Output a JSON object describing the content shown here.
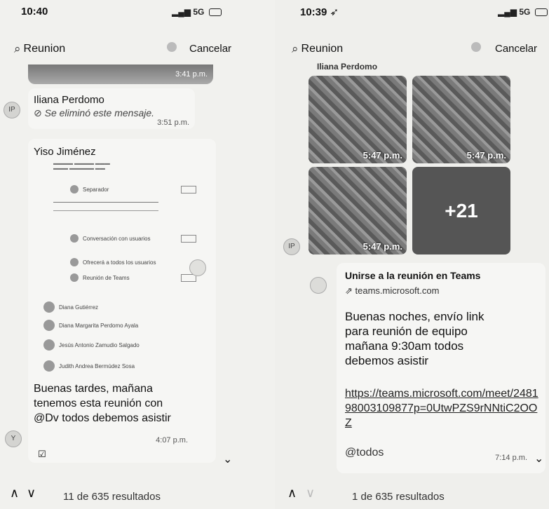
{
  "left": {
    "status_time": "10:40",
    "signal": "5G",
    "search_query": "Reunion",
    "cancel_label": "Cancelar",
    "top_image_time": "3:41 p.m.",
    "msg1": {
      "author": "Iliana Perdomo",
      "text": "Se eliminó este mensaje.",
      "time": "3:51 p.m."
    },
    "msg2": {
      "author": "Yiso Jiménez",
      "teams_rows": [
        "Separador",
        "Conversación con usuarios",
        "Ofrecerá a todos los usuarios",
        "Reunión de Teams"
      ],
      "participants": [
        "Diana Gutiérrez",
        "Diana Margarita Perdomo Ayala",
        "Jesús Antonio Zamudio Salgado",
        "Judith Andrea Bermúdez Sosa"
      ],
      "text": "Buenas tardes, mañana tenemos esta reunión con @Dv todos debemos asistir",
      "time": "4:07 p.m."
    },
    "results_text": "11 de 635 resultados"
  },
  "right": {
    "status_time": "10:39",
    "signal": "5G",
    "search_query": "Reunion",
    "cancel_label": "Cancelar",
    "sender_name": "Iliana Perdomo",
    "photo_times": [
      "5:47 p.m.",
      "5:47 p.m.",
      "5:47 p.m."
    ],
    "more_photos": "+21",
    "link_title": "Unirse a la reunión en Teams",
    "link_domain": "teams.microsoft.com",
    "message_text": "Buenas noches, envío link para reunión de equipo mañana 9:30am todos debemos asistir",
    "url": "https://teams.microsoft.com/meet/248198003109877p=0UtwPZS9rNNtiC2OOZ",
    "mention": "@todos",
    "time": "7:14 p.m.",
    "results_text": "1 de 635 resultados"
  }
}
